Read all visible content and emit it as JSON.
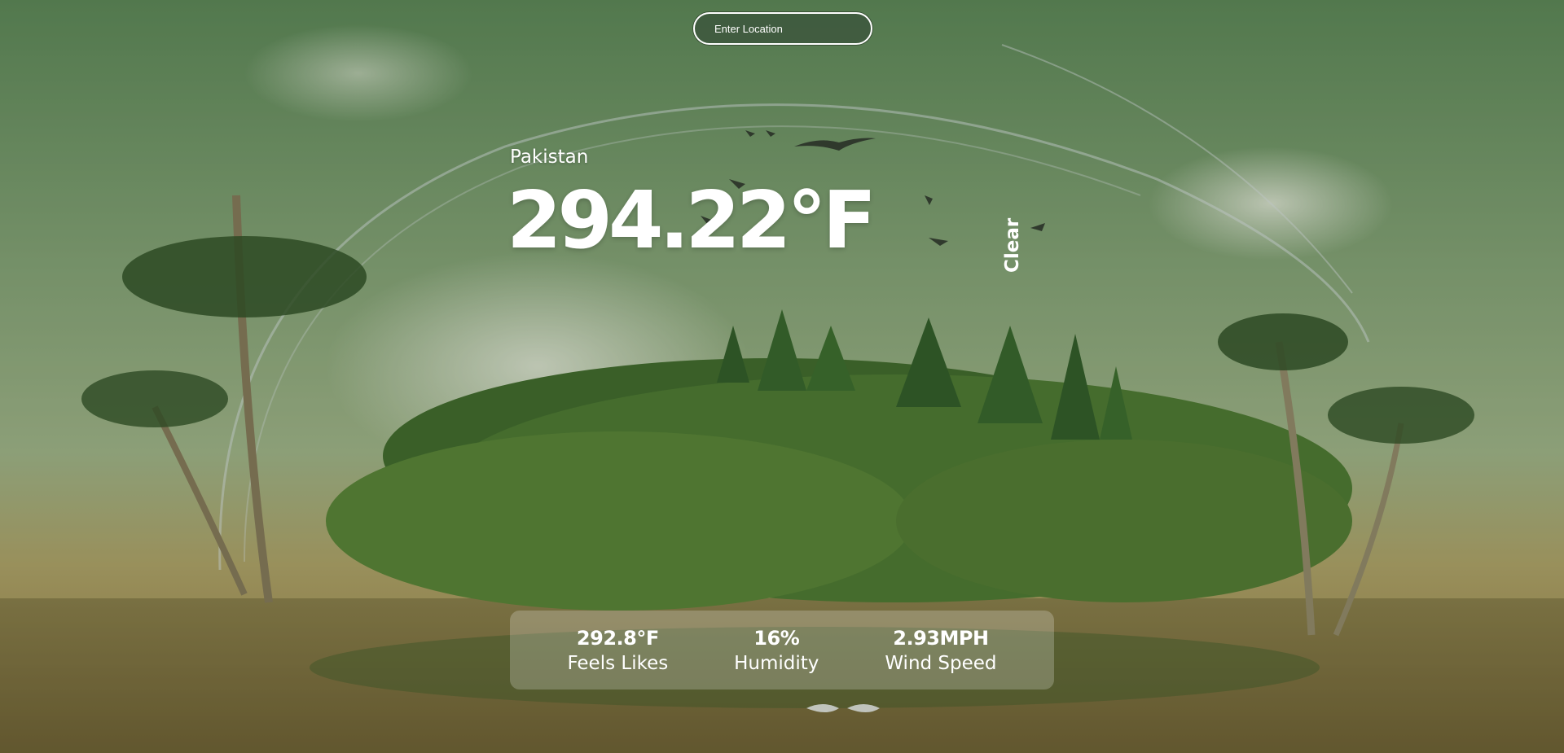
{
  "search": {
    "placeholder": "Enter Location"
  },
  "weather": {
    "location": "Pakistan",
    "temperature": "294.22°F",
    "condition": "Clear"
  },
  "stats": [
    {
      "value": "292.8°F",
      "label": "Feels Likes"
    },
    {
      "value": "16%",
      "label": "Humidity"
    },
    {
      "value": "2.93MPH",
      "label": "Wind Speed"
    }
  ],
  "colors": {
    "sky": "#6f8f5f",
    "water": "#a88a4f",
    "foliage": "#3f6a28",
    "text": "#ffffff"
  }
}
